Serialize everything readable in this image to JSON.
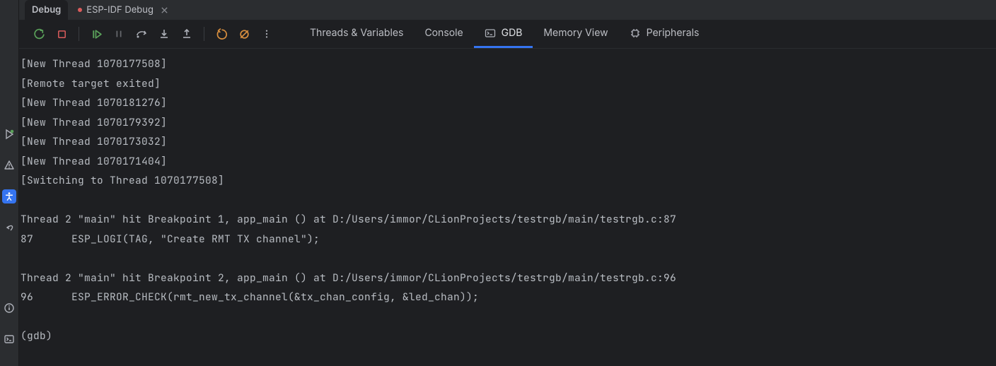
{
  "tabs": [
    {
      "label": "Debug",
      "active": true
    },
    {
      "label": "ESP-IDF Debug",
      "active": false,
      "closable": true,
      "has_indicator": true
    }
  ],
  "toolbar": {
    "rerun": "Rerun",
    "stop": "Stop",
    "resume": "Resume",
    "pause": "Pause",
    "step_over": "Step Over",
    "step_into": "Step Into",
    "step_out": "Step Out",
    "reset": "Reset",
    "mute": "Mute Breakpoints",
    "more": "More"
  },
  "view_tabs": [
    {
      "id": "threads",
      "label": "Threads & Variables",
      "icon": null,
      "active": false
    },
    {
      "id": "console",
      "label": "Console",
      "icon": null,
      "active": false
    },
    {
      "id": "gdb",
      "label": "GDB",
      "icon": "terminal",
      "active": true
    },
    {
      "id": "memory",
      "label": "Memory View",
      "icon": null,
      "active": false
    },
    {
      "id": "peripherals",
      "label": "Peripherals",
      "icon": "chip",
      "active": false
    }
  ],
  "console_lines": [
    "[New Thread 1070177508]",
    "[Remote target exited]",
    "[New Thread 1070181276]",
    "[New Thread 1070179392]",
    "[New Thread 1070173032]",
    "[New Thread 1070171404]",
    "[Switching to Thread 1070177508]",
    "",
    "Thread 2 \"main\" hit Breakpoint 1, app_main () at D:/Users/immor/CLionProjects/testrgb/main/testrgb.c:87",
    "87      ESP_LOGI(TAG, \"Create RMT TX channel\");",
    "",
    "Thread 2 \"main\" hit Breakpoint 2, app_main () at D:/Users/immor/CLionProjects/testrgb/main/testrgb.c:96",
    "96      ESP_ERROR_CHECK(rmt_new_tx_channel(&tx_chan_config, &led_chan));",
    "",
    "(gdb) "
  ],
  "rail": {
    "run": "Run",
    "problems": "Problems",
    "accessibility": "Accessibility",
    "nav": "Navigate",
    "notifications": "Notifications",
    "terminal": "Terminal"
  }
}
